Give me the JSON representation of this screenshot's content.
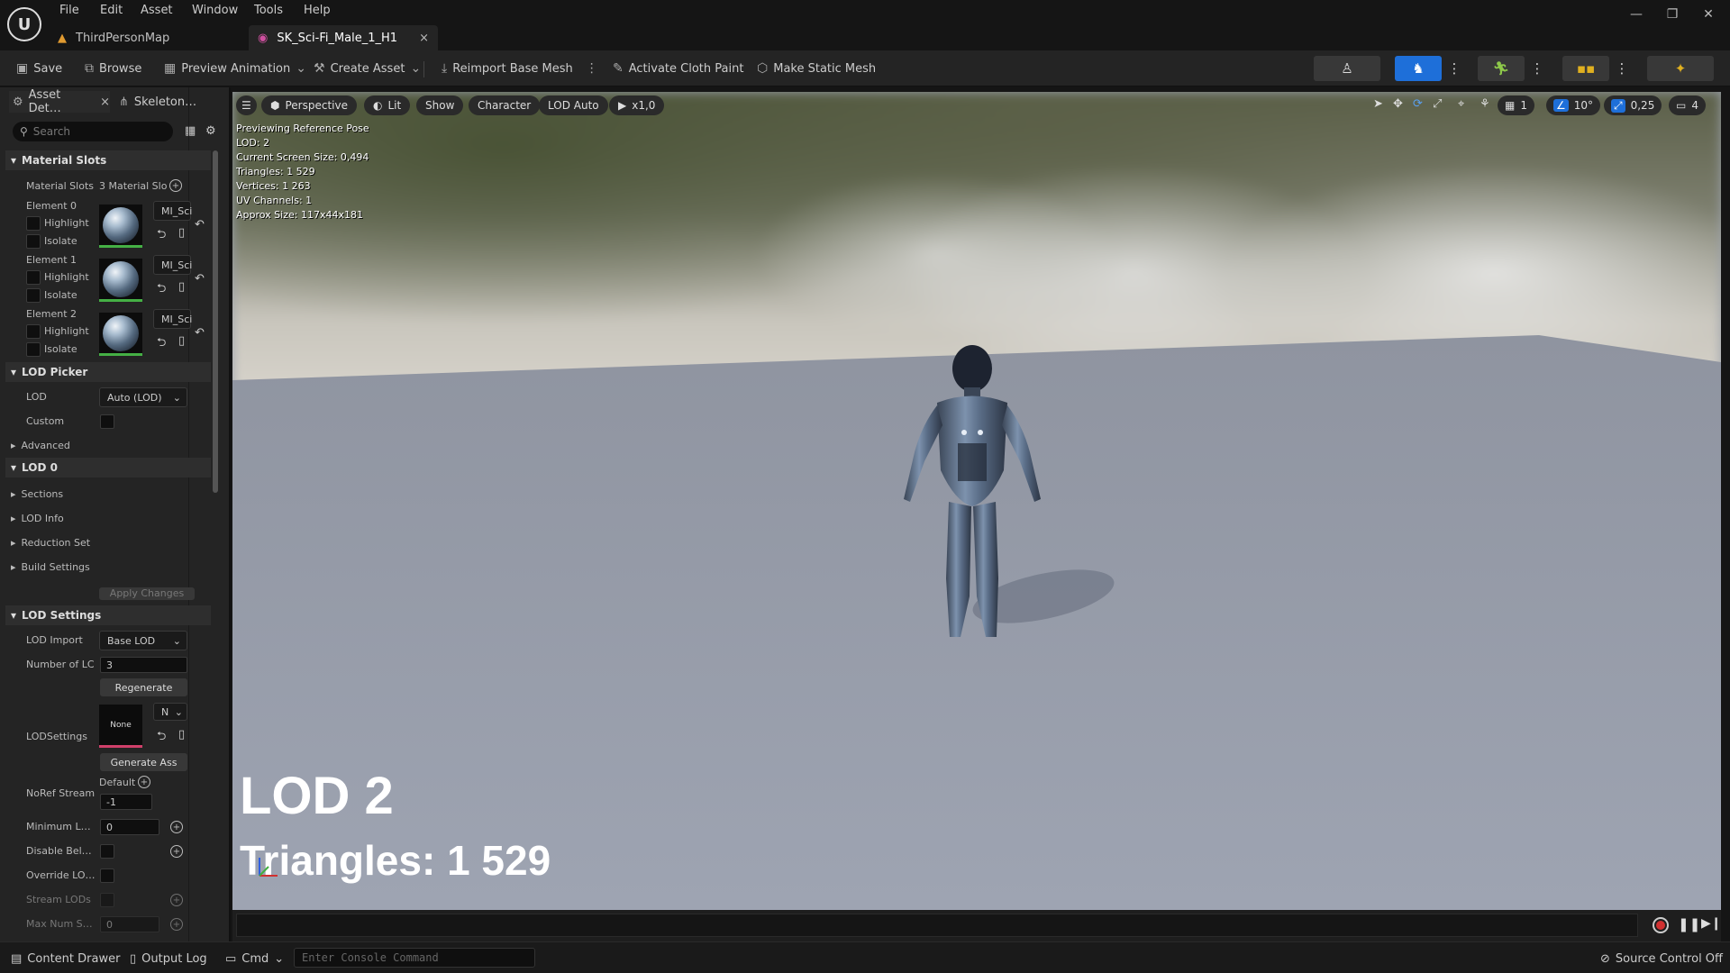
{
  "menu": [
    "File",
    "Edit",
    "Asset",
    "Window",
    "Tools",
    "Help"
  ],
  "tabs": [
    {
      "label": "ThirdPersonMap",
      "icon": "level-icon"
    },
    {
      "label": "SK_Sci-Fi_Male_1_H1",
      "icon": "skeletal-mesh-icon",
      "close": "×"
    }
  ],
  "window_controls": {
    "minimize": "—",
    "restore": "❐",
    "close": "✕"
  },
  "toolbar": {
    "save": "Save",
    "browse": "Browse",
    "preview_animation": "Preview Animation",
    "create_asset": "Create Asset",
    "reimport": "Reimport Base Mesh",
    "cloth_paint": "Activate Cloth Paint",
    "static_mesh": "Make Static Mesh"
  },
  "panel_tabs": {
    "asset_details": "Asset Det…",
    "skeleton": "Skeleton…",
    "close": "×"
  },
  "search": {
    "placeholder": "Search"
  },
  "material_slots": {
    "header": "Material Slots",
    "label": "Material Slots",
    "value": "3 Material Slo",
    "elements": [
      {
        "name": "Element 0",
        "material": "MI_Sci"
      },
      {
        "name": "Element 1",
        "material": "MI_Sci"
      },
      {
        "name": "Element 2",
        "material": "MI_Sci"
      }
    ],
    "highlight": "Highlight",
    "isolate": "Isolate"
  },
  "lod_picker": {
    "header": "LOD Picker",
    "lod_label": "LOD",
    "lod_value": "Auto (LOD)",
    "custom_label": "Custom",
    "advanced": "Advanced"
  },
  "lod0": {
    "header": "LOD 0",
    "items": [
      "Sections",
      "LOD Info",
      "Reduction Set",
      "Build Settings"
    ],
    "apply": "Apply Changes"
  },
  "lod_settings": {
    "header": "LOD Settings",
    "import_label": "LOD Import",
    "import_value": "Base LOD",
    "number_label": "Number of LC",
    "number_value": "3",
    "regenerate": "Regenerate",
    "lodsettings_label": "LODSettings",
    "lodsettings_thumb": "None",
    "lodsettings_dd": "N",
    "generate": "Generate Ass",
    "noref_label": "NoRef Stream",
    "noref_default": "Default",
    "noref_value": "-1",
    "minimum_label": "Minimum L…",
    "minimum_value": "0",
    "disable_label": "Disable Bel…",
    "override_label": "Override LO…",
    "stream_label": "Stream LODs",
    "maxnum_label": "Max Num S…",
    "maxnum_value": "0"
  },
  "viewport": {
    "menu": "☰",
    "perspective": "Perspective",
    "lit": "Lit",
    "show": "Show",
    "character": "Character",
    "lod": "LOD Auto",
    "play": "x1,0",
    "grid": "1",
    "angle": "10°",
    "scale": "0,25",
    "camera": "4",
    "stats": [
      "Previewing Reference Pose",
      "LOD: 2",
      "Current Screen Size: 0,494",
      "Triangles: 1 529",
      "Vertices: 1 263",
      "UV Channels: 1",
      "Approx Size: 117x44x181"
    ],
    "lod_big": "LOD 2",
    "triangles_big": "Triangles: 1 529"
  },
  "statusbar": {
    "content_drawer": "Content Drawer",
    "output_log": "Output Log",
    "cmd": "Cmd",
    "console_placeholder": "Enter Console Command",
    "source_control": "Source Control Off"
  },
  "colors": {
    "accent_blue": "#1e6fd9",
    "green_bar": "#45b045",
    "pink_bar": "#d0406a"
  }
}
